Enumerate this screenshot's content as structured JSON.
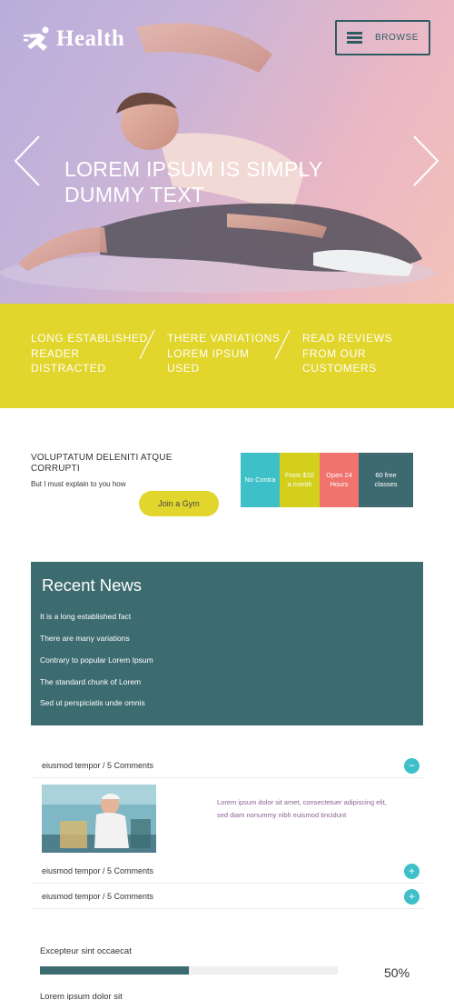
{
  "header": {
    "logo_text": "Health",
    "logo_icon": "runner-icon",
    "browse_label": "BROWSE",
    "browse_icon": "hamburger-icon"
  },
  "hero": {
    "title": "LOREM IPSUM IS SIMPLY DUMMY TEXT",
    "prev_icon": "chevron-left-icon",
    "next_icon": "chevron-right-icon"
  },
  "features": [
    {
      "text": "LONG ESTABLISHED READER DISTRACTED"
    },
    {
      "text": "THERE VARIATIONS LOREM IPSUM USED"
    },
    {
      "text": "READ REVIEWS FROM OUR CUSTOMERS"
    }
  ],
  "join": {
    "title": "VOLUPTATUM DELENITI ATQUE CORRUPTI",
    "subtitle": "But I must explain to you how",
    "button_label": "Join a Gym"
  },
  "pricing": [
    {
      "text": "No Contra"
    },
    {
      "text": "From $10\na month"
    },
    {
      "text": "Open 24\nHours"
    },
    {
      "text": "60 free\nclasses"
    }
  ],
  "news": {
    "title": "Recent News",
    "items": [
      "It is a long established fact",
      "There are many variations",
      "Contrary to popular Lorem Ipsum",
      "The standard chunk of Lorem",
      "Sed ut perspiciatis unde omnis"
    ]
  },
  "accordion": {
    "rows": [
      {
        "label": "eiusmod tempor / 5 Comments",
        "state": "expanded",
        "toggle": "−"
      },
      {
        "label": "eiusmod tempor / 5 Comments",
        "state": "collapsed",
        "toggle": "+"
      },
      {
        "label": "eiusmod tempor / 5 Comments",
        "state": "collapsed",
        "toggle": "+"
      }
    ],
    "expanded_text": "Lorem ipsum dolor sit amet, consectetuer adipiscing elit, sed diam nonummy nibh euismod tincidunt"
  },
  "progress": {
    "label": "Excepteur sint occaecat",
    "value_text": "50%",
    "fraction": 0.5,
    "next_label": "Lorem ipsum dolor sit"
  },
  "colors": {
    "yellow": "#e2d52c",
    "teal_dark": "#3c6b70",
    "cyan": "#3dc0c8",
    "coral": "#f0736e"
  }
}
